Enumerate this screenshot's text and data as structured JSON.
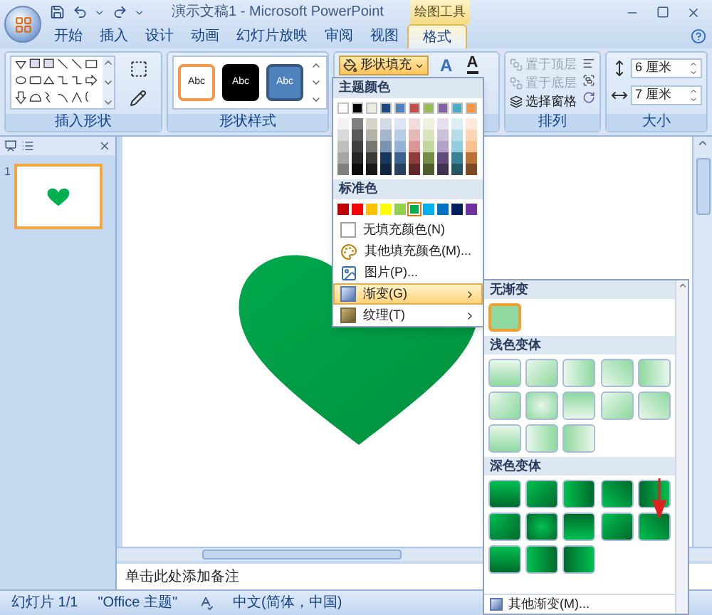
{
  "window": {
    "title": "演示文稿1 - Microsoft PowerPoint",
    "context_label": "绘图工具"
  },
  "tabs": [
    {
      "label": "开始",
      "selected": false
    },
    {
      "label": "插入",
      "selected": false
    },
    {
      "label": "设计",
      "selected": false
    },
    {
      "label": "动画",
      "selected": false
    },
    {
      "label": "幻灯片放映",
      "selected": false
    },
    {
      "label": "审阅",
      "selected": false
    },
    {
      "label": "视图",
      "selected": false
    },
    {
      "label": "格式",
      "selected": true
    }
  ],
  "ribbon": {
    "insert_shapes": {
      "label": "插入形状"
    },
    "shape_styles": {
      "label": "形状样式",
      "styles": [
        {
          "label": "Abc",
          "kind": "outline",
          "color": "#f79646"
        },
        {
          "label": "Abc",
          "kind": "solid",
          "color": "#000000"
        },
        {
          "label": "Abc",
          "kind": "solid",
          "color": "#4f81bd"
        }
      ]
    },
    "fill_button": {
      "label": "形状填充",
      "open": true
    },
    "wordart": {
      "letters": [
        "A",
        "A"
      ]
    },
    "arrange": {
      "label": "排列",
      "buttons": [
        {
          "label": "置于顶层",
          "disabled": true
        },
        {
          "label": "置于底层",
          "disabled": true
        },
        {
          "label": "选择窗格",
          "disabled": false
        }
      ]
    },
    "size": {
      "label": "大小",
      "fields": [
        {
          "kind": "height",
          "value": "6 厘米"
        },
        {
          "kind": "width",
          "value": "7 厘米"
        }
      ]
    }
  },
  "fill_menu": {
    "theme_header": "主题颜色",
    "theme_colors": [
      {
        "color": "#ffffff"
      },
      {
        "color": "#000000"
      },
      {
        "color": "#eeece1"
      },
      {
        "color": "#1f497d"
      },
      {
        "color": "#4f81bd"
      },
      {
        "color": "#c0504d"
      },
      {
        "color": "#9bbb59"
      },
      {
        "color": "#8064a2"
      },
      {
        "color": "#4bacc6"
      },
      {
        "color": "#f79646"
      }
    ],
    "standard_header": "标准色",
    "standard_colors": [
      {
        "color": "#c00000",
        "selected": false
      },
      {
        "color": "#ff0000",
        "selected": false
      },
      {
        "color": "#ffc000",
        "selected": false
      },
      {
        "color": "#ffff00",
        "selected": false
      },
      {
        "color": "#92d050",
        "selected": false
      },
      {
        "color": "#00b050",
        "selected": true
      },
      {
        "color": "#00b0f0",
        "selected": false
      },
      {
        "color": "#0070c0",
        "selected": false
      },
      {
        "color": "#002060",
        "selected": false
      },
      {
        "color": "#7030a0",
        "selected": false
      }
    ],
    "items": [
      {
        "label": "无填充颜色(N)",
        "kind": "none",
        "submenu": false,
        "highlighted": false
      },
      {
        "label": "其他填充颜色(M)...",
        "kind": "palette",
        "submenu": false,
        "highlighted": false
      },
      {
        "label": "图片(P)...",
        "kind": "picture",
        "submenu": false,
        "highlighted": false
      },
      {
        "label": "渐变(G)",
        "kind": "gradient",
        "submenu": true,
        "highlighted": true
      },
      {
        "label": "纹理(T)",
        "kind": "texture",
        "submenu": true,
        "highlighted": false
      }
    ]
  },
  "gradient_menu": {
    "sections": [
      {
        "title": "无渐变",
        "kind": "flat",
        "swatches": [
          {
            "kind": "none",
            "selected": true
          }
        ]
      },
      {
        "title": "浅色变体",
        "kind": "light",
        "swatches": [
          {
            "kind": "down",
            "selected": false
          },
          {
            "kind": "diag-down",
            "selected": false
          },
          {
            "kind": "right",
            "selected": false
          },
          {
            "kind": "diag-up",
            "selected": false
          },
          {
            "kind": "left",
            "selected": false
          },
          {
            "kind": "corner",
            "selected": false
          },
          {
            "kind": "center",
            "selected": false
          },
          {
            "kind": "up",
            "selected": false
          },
          {
            "kind": "diag-down",
            "selected": false
          },
          {
            "kind": "diag-up",
            "selected": false
          },
          {
            "kind": "down",
            "selected": false
          },
          {
            "kind": "right",
            "selected": false
          },
          {
            "kind": "left",
            "selected": false
          }
        ]
      },
      {
        "title": "深色变体",
        "kind": "dark",
        "swatches": [
          {
            "kind": "down",
            "selected": false
          },
          {
            "kind": "diag-down",
            "selected": false
          },
          {
            "kind": "right",
            "selected": false
          },
          {
            "kind": "diag-up",
            "selected": false
          },
          {
            "kind": "left",
            "selected": false
          },
          {
            "kind": "corner",
            "selected": false
          },
          {
            "kind": "center",
            "selected": false
          },
          {
            "kind": "up",
            "selected": false
          },
          {
            "kind": "diag-down",
            "selected": false
          },
          {
            "kind": "diag-up",
            "selected": false
          },
          {
            "kind": "down",
            "selected": false
          },
          {
            "kind": "right",
            "selected": false
          },
          {
            "kind": "left",
            "selected": false
          }
        ]
      }
    ],
    "footer": "其他渐变(M)..."
  },
  "slides_pane": {
    "slides": [
      {
        "number": "1",
        "selected": true
      }
    ]
  },
  "notes": {
    "placeholder": "单击此处添加备注"
  },
  "status_bar": {
    "slide": "幻灯片 1/1",
    "theme": "\"Office 主题\"",
    "language": "中文(简体，中国)"
  }
}
